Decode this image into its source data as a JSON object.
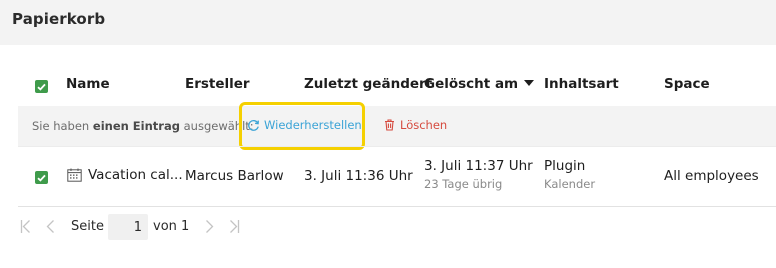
{
  "page": {
    "title": "Papierkorb"
  },
  "table": {
    "columns": {
      "name": "Name",
      "creator": "Ersteller",
      "last_modified": "Zuletzt geändert",
      "deleted_at": "Gelöscht am",
      "content_type": "Inhaltsart",
      "space": "Space"
    },
    "selection": {
      "prefix": "Sie haben ",
      "count_text": "einen Eintrag",
      "suffix": " ausgewählt:",
      "restore_label": "Wiederherstellen",
      "delete_label": "Löschen"
    },
    "rows": [
      {
        "checked": true,
        "icon": "calendar-icon",
        "name": "Vacation cal...",
        "creator": "Marcus Barlow",
        "last_modified": "3. Juli 11:36 Uhr",
        "deleted_at": "3. Juli 11:37 Uhr",
        "days_left": "23 Tage übrig",
        "content_type": "Plugin",
        "content_subtype": "Kalender",
        "space": "All employees"
      }
    ]
  },
  "pagination": {
    "page_label": "Seite",
    "current_page": "1",
    "of_label": "von 1"
  },
  "colors": {
    "accent_green": "#3f9b4b",
    "restore_blue": "#3aa3d6",
    "delete_red": "#d64b3f",
    "highlight_yellow": "#f5d000"
  }
}
